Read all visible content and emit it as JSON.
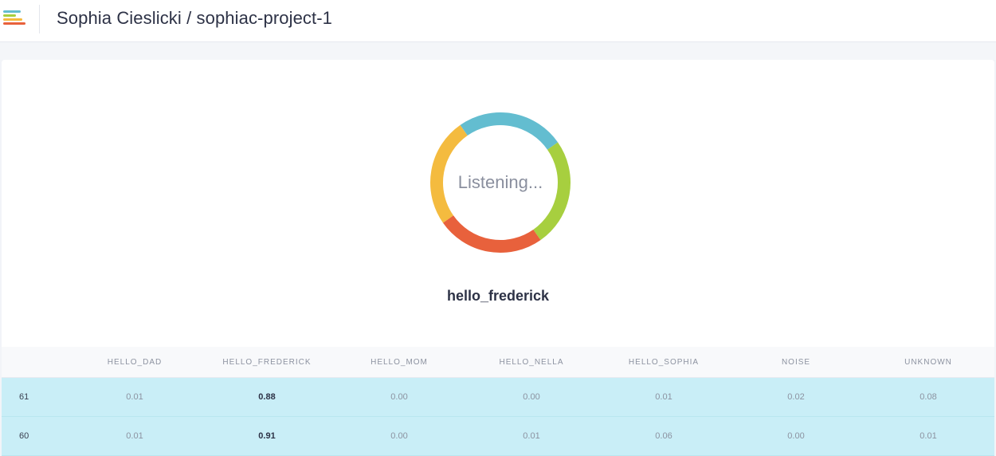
{
  "header": {
    "title": "Sophia Cieslicki / sophiac-project-1"
  },
  "classifier": {
    "status_text": "Listening...",
    "ring_colors": [
      "#63bdd0",
      "#a7cf3f",
      "#e8613c",
      "#f4bb3f"
    ],
    "prediction": "hello_frederick"
  },
  "table": {
    "columns": [
      "",
      "HELLO_DAD",
      "HELLO_FREDERICK",
      "HELLO_MOM",
      "HELLO_NELLA",
      "HELLO_SOPHIA",
      "NOISE",
      "UNKNOWN"
    ],
    "rows": [
      {
        "id": "61",
        "values": [
          "0.01",
          "0.88",
          "0.00",
          "0.00",
          "0.01",
          "0.02",
          "0.08"
        ]
      },
      {
        "id": "60",
        "values": [
          "0.01",
          "0.91",
          "0.00",
          "0.01",
          "0.06",
          "0.00",
          "0.01"
        ]
      }
    ],
    "highlight_color": "#c9eef7"
  }
}
